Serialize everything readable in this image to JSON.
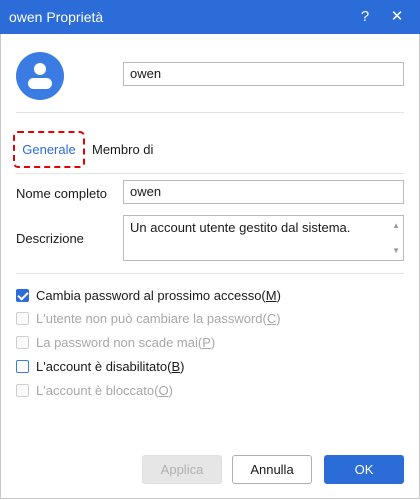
{
  "window": {
    "title": "owen Proprietà",
    "help_glyph": "?",
    "close_glyph": "✕"
  },
  "account": {
    "name_value": "owen"
  },
  "tabs": {
    "general": "Generale",
    "member_of": "Membro di"
  },
  "fields": {
    "full_name_label": "Nome completo",
    "full_name_value": "owen",
    "description_label": "Descrizione",
    "description_value": "Un account utente gestito dal sistema."
  },
  "options": [
    {
      "pre": "Cambia password al prossimo accesso(",
      "key": "M",
      "post": ")",
      "checked": true,
      "enabled": true
    },
    {
      "pre": "L'utente non può cambiare la password(",
      "key": "C",
      "post": ")",
      "checked": false,
      "enabled": false
    },
    {
      "pre": "La password non scade mai(",
      "key": "P",
      "post": ")",
      "checked": false,
      "enabled": false
    },
    {
      "pre": "L'account è disabilitato(",
      "key": "B",
      "post": ")",
      "checked": false,
      "enabled": true
    },
    {
      "pre": "L'account è bloccato(",
      "key": "O",
      "post": ")",
      "checked": false,
      "enabled": false
    }
  ],
  "buttons": {
    "apply": "Applica",
    "cancel": "Annulla",
    "ok": "OK"
  },
  "colors": {
    "accent": "#2b6cd9",
    "highlight_border": "#e60000"
  },
  "icons": {
    "avatar": "user-icon",
    "help": "help-icon",
    "close": "close-icon"
  }
}
